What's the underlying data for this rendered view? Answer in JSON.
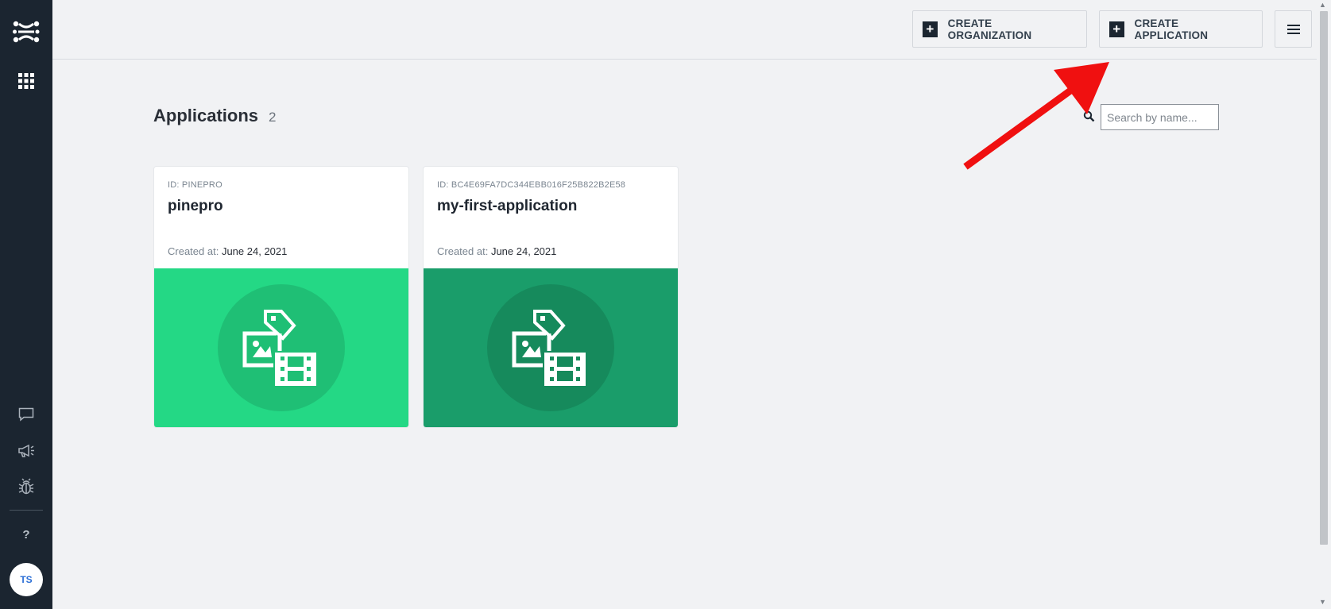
{
  "sidebar": {
    "avatar_initials": "TS",
    "help_label": "?",
    "icons": [
      "logo-icon",
      "apps-grid-icon",
      "chat-icon",
      "megaphone-icon",
      "bug-icon",
      "help-icon"
    ]
  },
  "topbar": {
    "create_org_label": "CREATE ORGANIZATION",
    "create_app_label": "CREATE APPLICATION",
    "plus_glyph": "+"
  },
  "main": {
    "title": "Applications",
    "count": "2",
    "search_placeholder": "Search by name..."
  },
  "cards": [
    {
      "id": "ID: PINEPRO",
      "name": "pinepro",
      "created_label": "Created at:",
      "created_value": "June 24, 2021",
      "banner_color": "#24d885"
    },
    {
      "id": "ID: BC4E69FA7DC344EBB016F25B822B2E58",
      "name": "my-first-application",
      "created_label": "Created at:",
      "created_value": "June 24, 2021",
      "banner_color": "#1a9d6a"
    }
  ],
  "colors": {
    "sidebar_bg": "#1b2530",
    "page_bg": "#f1f2f4",
    "arrow": "#f01010"
  }
}
